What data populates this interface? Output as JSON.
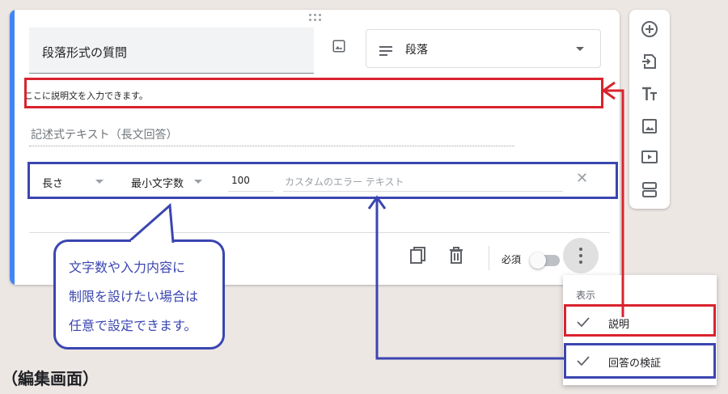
{
  "question": {
    "title": "段落形式の質問",
    "type_label": "段落",
    "description": "ここに説明文を入力できます。",
    "answer_placeholder": "記述式テキスト（長文回答）"
  },
  "validation": {
    "rule_type": "長さ",
    "condition": "最小文字数",
    "value": "100",
    "error_placeholder": "カスタムのエラー テキスト",
    "clear_symbol": "✕"
  },
  "footer": {
    "required_label": "必須"
  },
  "menu": {
    "header": "表示",
    "items": [
      {
        "label": "説明",
        "checked": true
      },
      {
        "label": "回答の検証",
        "checked": true
      }
    ]
  },
  "toolbar": {
    "icons": [
      "add-question-icon",
      "import-questions-icon",
      "add-title-icon",
      "add-image-icon",
      "add-video-icon",
      "add-section-icon"
    ]
  },
  "annotation": {
    "bubble_lines": [
      "文字数や入力内容に",
      "制限を設けたい場合は",
      "任意で設定できます。"
    ],
    "caption": "（編集画面）"
  },
  "colors": {
    "accent": "#4285f4",
    "annotation_red": "#d9232e",
    "annotation_blue": "#3b46b0",
    "background": "#ede7e4"
  }
}
